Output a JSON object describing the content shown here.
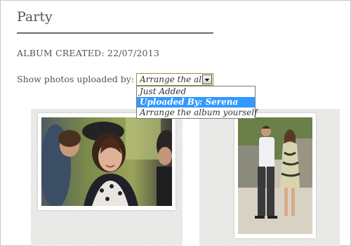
{
  "album": {
    "title": "Party",
    "created_label": "ALBUM CREATED: 22/07/2013"
  },
  "filter": {
    "label": "Show photos uploaded by:",
    "selected_value": "Arrange the album yourself",
    "options": [
      {
        "label": "Just Added",
        "selected": false
      },
      {
        "label": "Uploaded By: Serena",
        "selected": true
      },
      {
        "label": "Arrange the album yourself",
        "selected": false
      }
    ]
  },
  "colors": {
    "highlight": "#3399ff",
    "select_border": "#a88a3a"
  },
  "gallery": {
    "photos": [
      {
        "alt": "woman in hat smiling at party",
        "icon": "photo"
      },
      {
        "alt": "couple standing outdoors",
        "icon": "photo"
      }
    ]
  }
}
